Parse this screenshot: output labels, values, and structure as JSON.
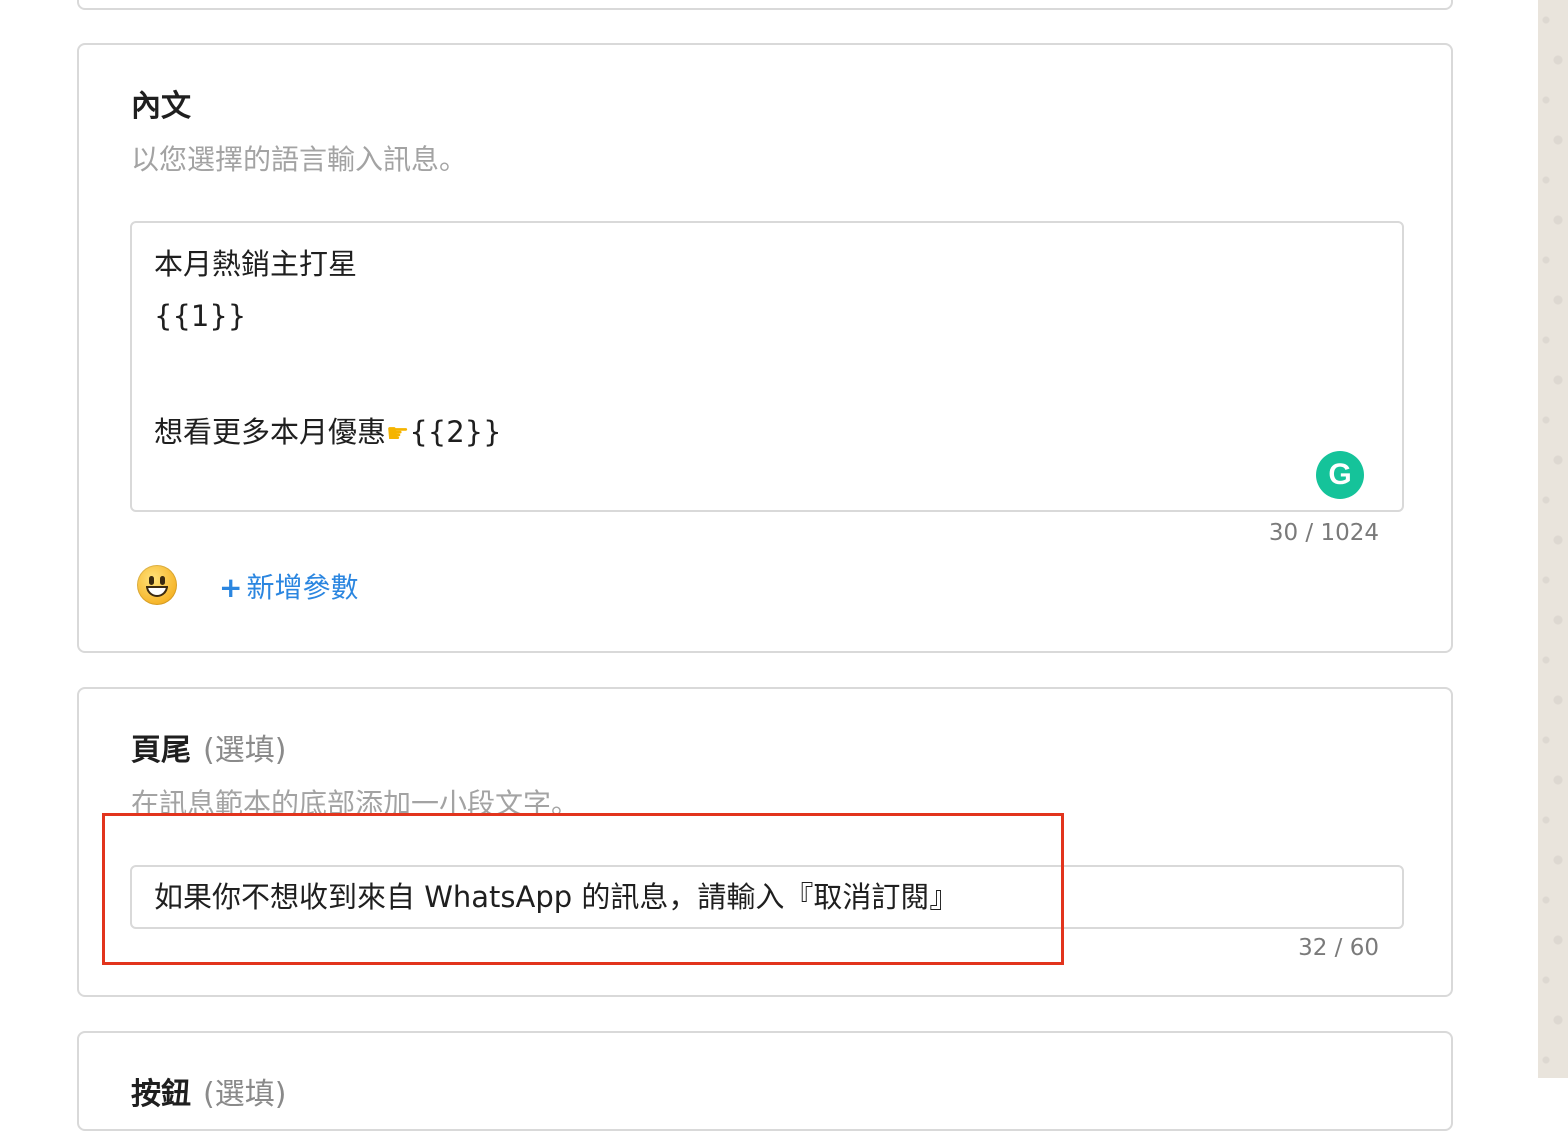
{
  "body_section": {
    "title": "內文",
    "description": "以您選擇的語言輸入訊息。",
    "lines": [
      "本月熱銷主打星",
      "{{1}}",
      "想看更多本月優惠",
      "{{2}}"
    ],
    "counter": "30 / 1024",
    "grammarly_letter": "G",
    "add_param_plus": "+",
    "add_param_label": "新增參數"
  },
  "footer_section": {
    "title": "頁尾",
    "optional": "(選填)",
    "description": "在訊息範本的底部添加一小段文字。",
    "input_value": "如果你不想收到來自 WhatsApp 的訊息，請輸入『取消訂閱』",
    "counter": "32 / 60"
  },
  "buttons_section": {
    "title": "按鈕",
    "optional": "(選填)"
  },
  "icons": {
    "emoji": "grinning-face-icon",
    "pointing": "backhand-index-pointing-right-icon",
    "grammarly": "grammarly-icon"
  },
  "colors": {
    "link": "#2b86e0",
    "highlight": "#e2341d",
    "grammarly": "#15c39a",
    "border": "#d9d9d9"
  }
}
